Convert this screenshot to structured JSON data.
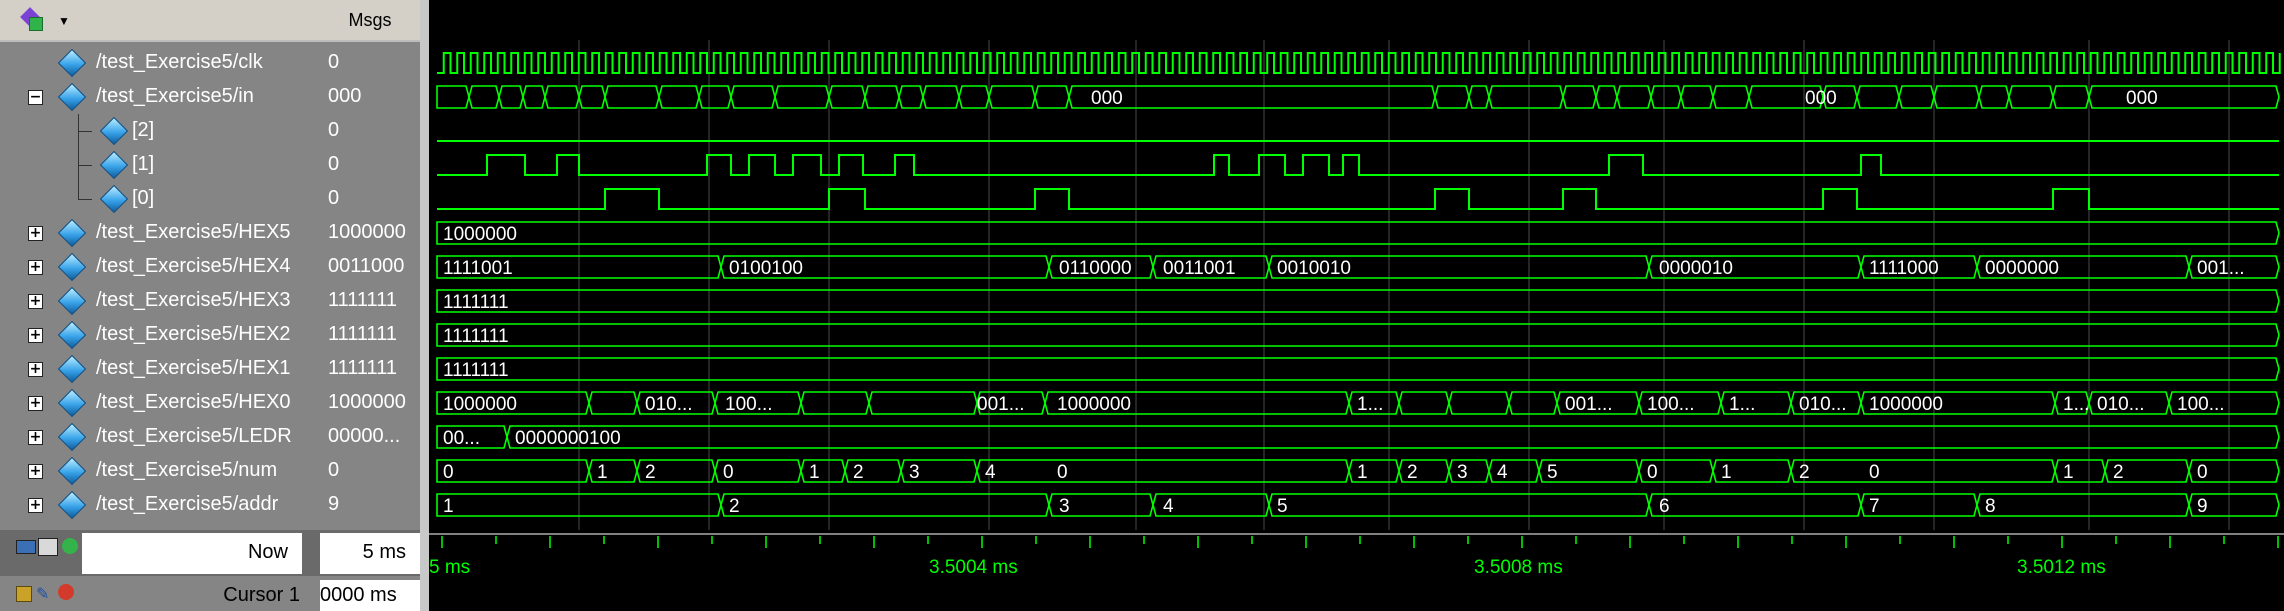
{
  "toolbar": {
    "icon": "wave-add-icon",
    "dropdown": "chevron-down-icon"
  },
  "headers": {
    "msgs": "Msgs"
  },
  "signals": [
    {
      "name": "/test_Exercise5/clk",
      "value": "0",
      "indent": 1,
      "expand": "none"
    },
    {
      "name": "/test_Exercise5/in",
      "value": "000",
      "indent": 1,
      "expand": "minus"
    },
    {
      "name": "[2]",
      "value": "0",
      "indent": 2,
      "expand": "none"
    },
    {
      "name": "[1]",
      "value": "0",
      "indent": 2,
      "expand": "none"
    },
    {
      "name": "[0]",
      "value": "0",
      "indent": 2,
      "expand": "none"
    },
    {
      "name": "/test_Exercise5/HEX5",
      "value": "1000000",
      "indent": 1,
      "expand": "plus"
    },
    {
      "name": "/test_Exercise5/HEX4",
      "value": "0011000",
      "indent": 1,
      "expand": "plus"
    },
    {
      "name": "/test_Exercise5/HEX3",
      "value": "1111111",
      "indent": 1,
      "expand": "plus"
    },
    {
      "name": "/test_Exercise5/HEX2",
      "value": "1111111",
      "indent": 1,
      "expand": "plus"
    },
    {
      "name": "/test_Exercise5/HEX1",
      "value": "1111111",
      "indent": 1,
      "expand": "plus"
    },
    {
      "name": "/test_Exercise5/HEX0",
      "value": "1000000",
      "indent": 1,
      "expand": "plus"
    },
    {
      "name": "/test_Exercise5/LEDR",
      "value": "00000...",
      "indent": 1,
      "expand": "plus"
    },
    {
      "name": "/test_Exercise5/num",
      "value": "0",
      "indent": 1,
      "expand": "plus"
    },
    {
      "name": "/test_Exercise5/addr",
      "value": "9",
      "indent": 1,
      "expand": "plus"
    }
  ],
  "waves": {
    "in": [
      "000",
      "000",
      "000"
    ],
    "bus_labels": {
      "HEX5": [
        "1000000"
      ],
      "HEX4": [
        "1111001",
        "0100100",
        "0110000",
        "0011001",
        "0010010",
        "0000010",
        "1111000",
        "0000000",
        "001..."
      ],
      "HEX3": [
        "1111111"
      ],
      "HEX2": [
        "1111111"
      ],
      "HEX1": [
        "1111111"
      ],
      "HEX0": [
        "1000000",
        "010...",
        "100...",
        "001...",
        "1000000",
        "1...",
        "001...",
        "100...",
        "1...",
        "010...",
        "1000000",
        "1...",
        "010...",
        "100..."
      ],
      "LEDR": [
        "00...",
        "0000000100"
      ],
      "num": [
        "0",
        "1",
        "2",
        "0",
        "1",
        "2",
        "3",
        "4",
        "0",
        "1",
        "2",
        "3",
        "4",
        "5",
        "0",
        "1",
        "2",
        "0",
        "1",
        "2",
        "0"
      ],
      "addr": [
        "1",
        "2",
        "3",
        "4",
        "5",
        "6",
        "7",
        "8",
        "9"
      ]
    }
  },
  "status": {
    "now_label": "Now",
    "now_value": "5 ms",
    "cursor_label": "Cursor 1",
    "cursor_value": "0000 ms",
    "ticks": [
      "5 ms",
      "3.5004 ms",
      "3.5008 ms",
      "3.5012 ms"
    ]
  },
  "colors": {
    "wave": "#00ff00",
    "panel": "#858585",
    "text": "#ffffff",
    "grid": "#555555"
  }
}
